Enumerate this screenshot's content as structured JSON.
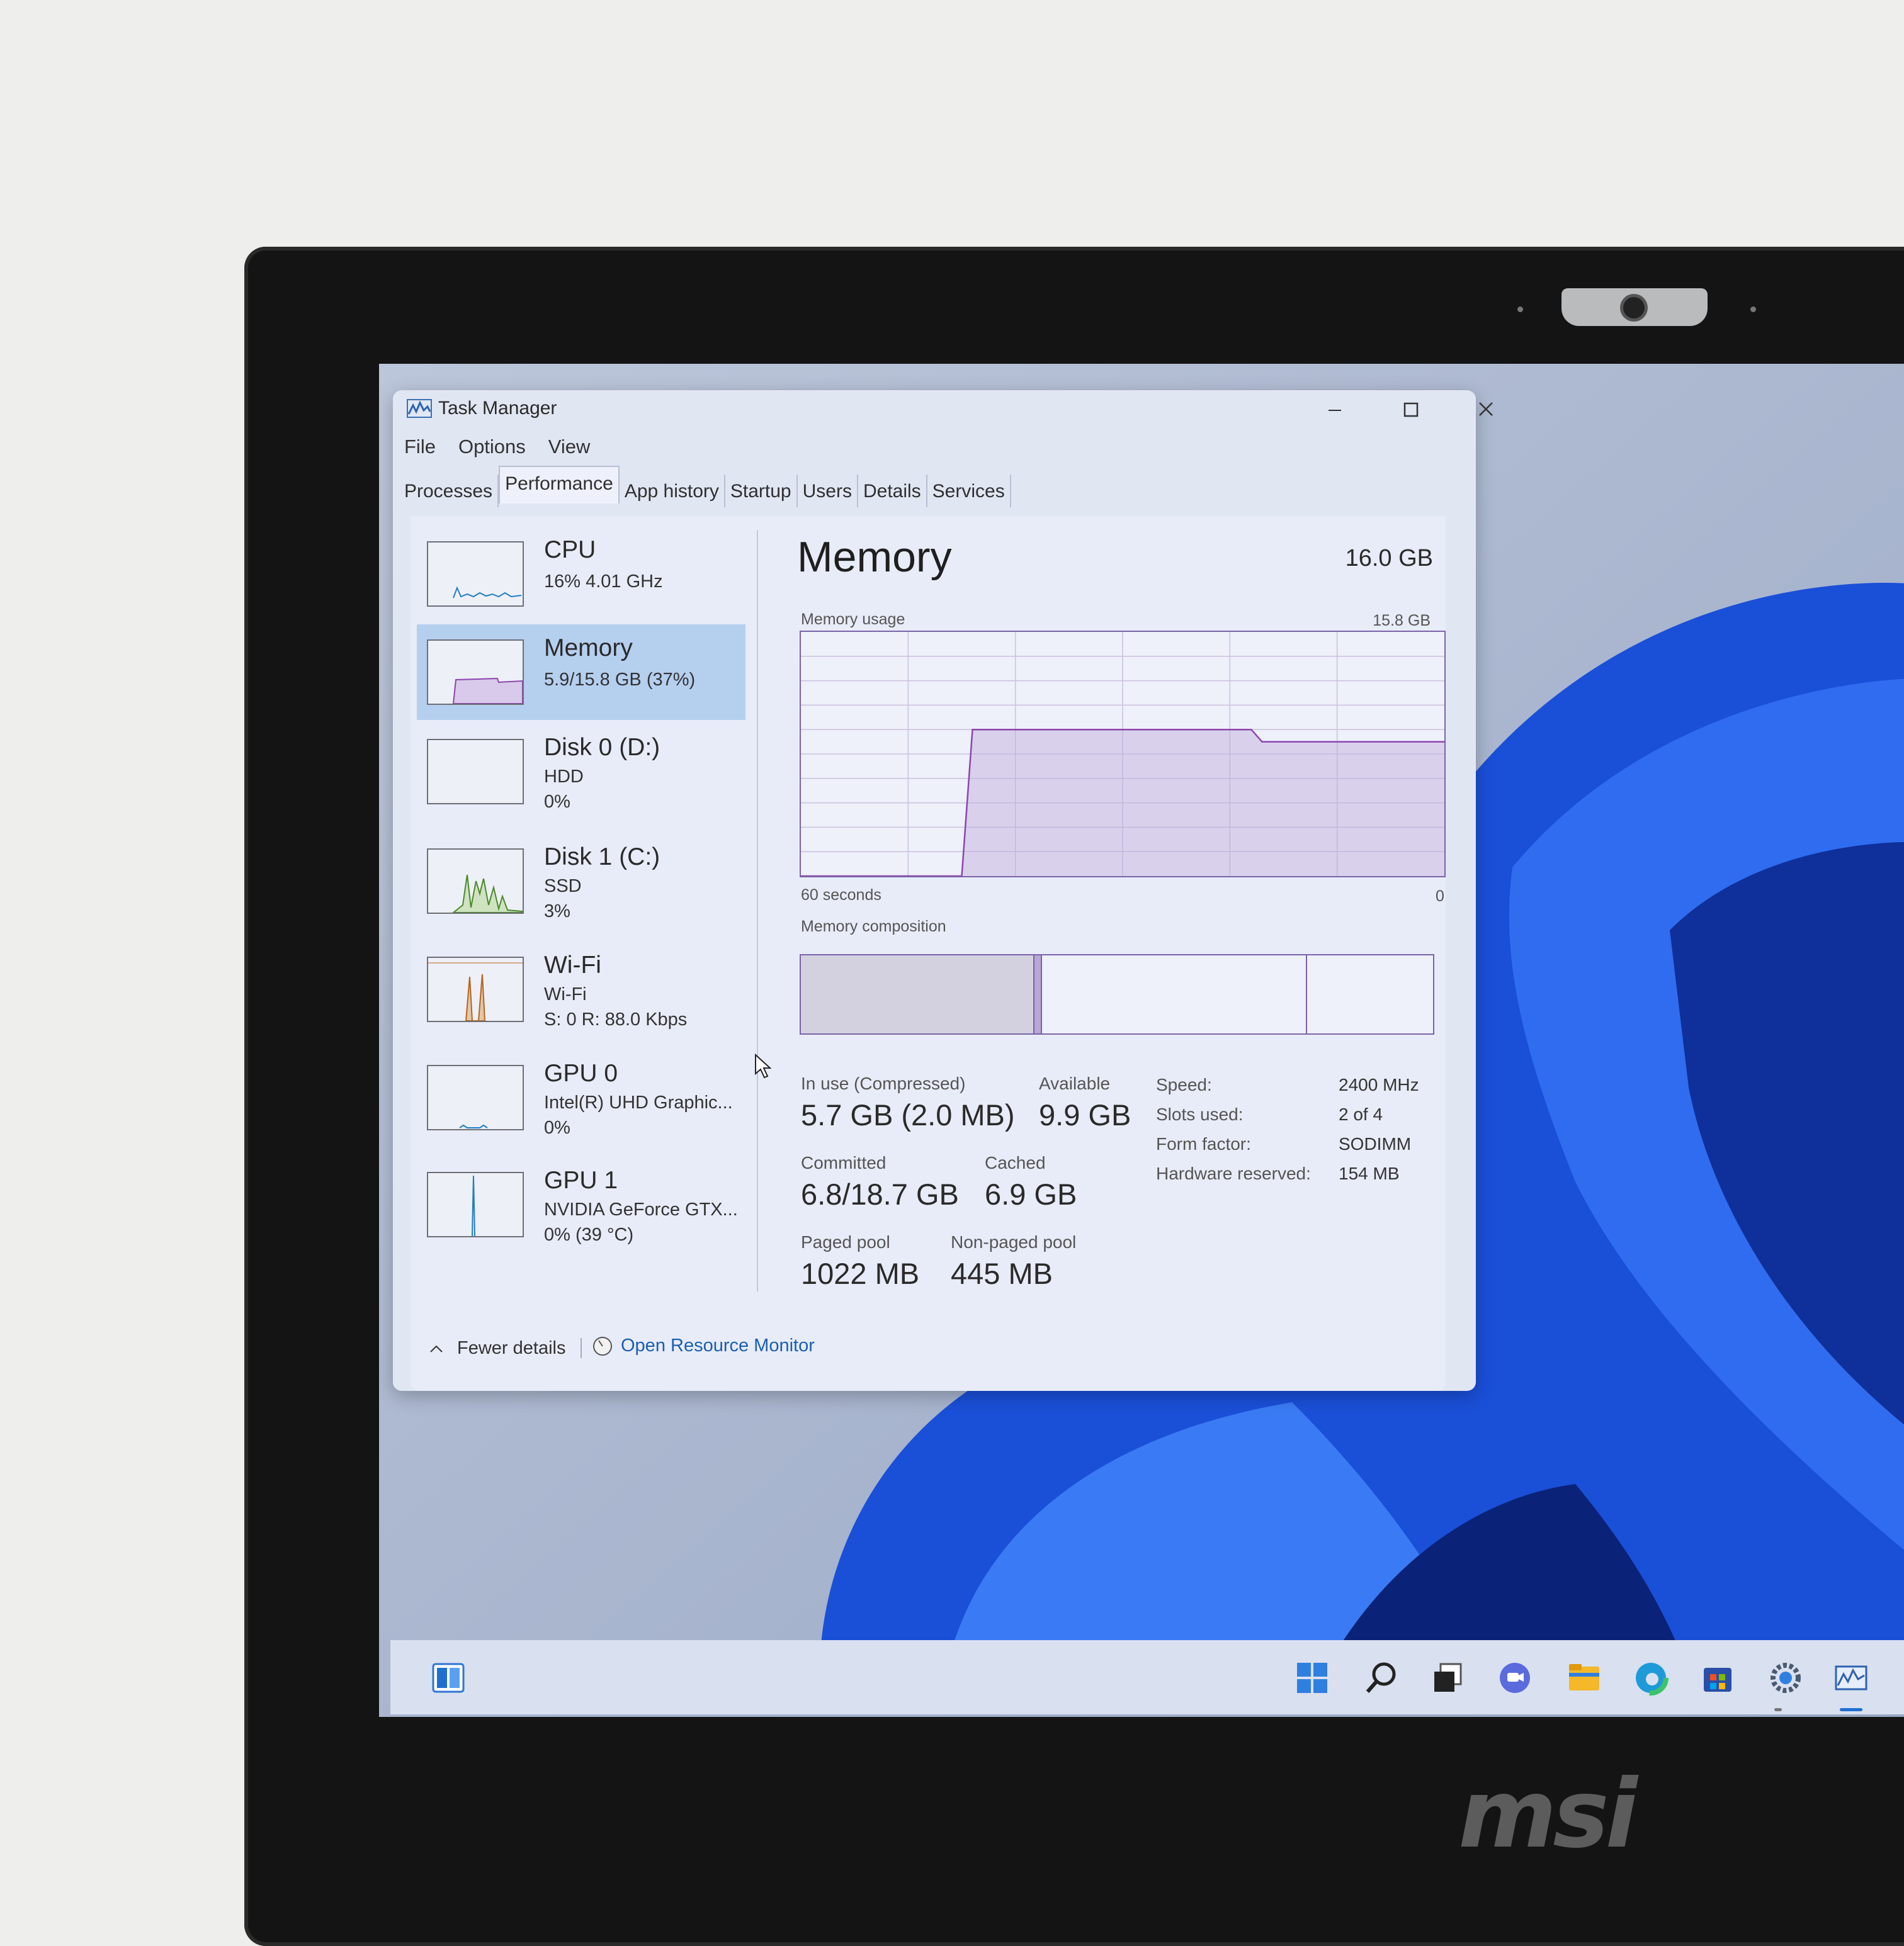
{
  "window": {
    "title": "Task Manager",
    "menu": [
      "File",
      "Options",
      "View"
    ],
    "tabs": [
      {
        "label": "Processes",
        "active": false
      },
      {
        "label": "Performance",
        "active": true
      },
      {
        "label": "App history",
        "active": false
      },
      {
        "label": "Startup",
        "active": false
      },
      {
        "label": "Users",
        "active": false
      },
      {
        "label": "Details",
        "active": false
      },
      {
        "label": "Services",
        "active": false
      }
    ]
  },
  "sidebar": [
    {
      "title": "CPU",
      "lines": [
        "16%  4.01 GHz"
      ],
      "color": "#1f7dc4"
    },
    {
      "title": "Memory",
      "lines": [
        "5.9/15.8 GB (37%)"
      ],
      "color": "#8e44ad",
      "selected": true
    },
    {
      "title": "Disk 0 (D:)",
      "lines": [
        "HDD",
        "0%"
      ],
      "color": "#4a8a2a"
    },
    {
      "title": "Disk 1 (C:)",
      "lines": [
        "SSD",
        "3%"
      ],
      "color": "#4a8a2a"
    },
    {
      "title": "Wi-Fi",
      "lines": [
        "Wi-Fi",
        "S: 0  R: 88.0 Kbps"
      ],
      "color": "#b5651d"
    },
    {
      "title": "GPU 0",
      "lines": [
        "Intel(R) UHD Graphic...",
        "0%"
      ],
      "color": "#1f7dc4"
    },
    {
      "title": "GPU 1",
      "lines": [
        "NVIDIA GeForce GTX...",
        "0%  (39 °C)"
      ],
      "color": "#1f7dc4"
    }
  ],
  "memory": {
    "heading": "Memory",
    "total": "16.0 GB",
    "usage_label": "Memory usage",
    "usage_max": "15.8 GB",
    "time_left": "60 seconds",
    "time_right": "0",
    "composition_label": "Memory composition",
    "stats": {
      "in_use_label": "In use (Compressed)",
      "in_use_value": "5.7 GB (2.0 MB)",
      "available_label": "Available",
      "available_value": "9.9 GB",
      "committed_label": "Committed",
      "committed_value": "6.8/18.7 GB",
      "cached_label": "Cached",
      "cached_value": "6.9 GB",
      "paged_label": "Paged pool",
      "paged_value": "1022 MB",
      "nonpaged_label": "Non-paged pool",
      "nonpaged_value": "445 MB"
    },
    "specs": [
      {
        "label": "Speed:",
        "value": "2400 MHz"
      },
      {
        "label": "Slots used:",
        "value": "2 of 4"
      },
      {
        "label": "Form factor:",
        "value": "SODIMM"
      },
      {
        "label": "Hardware reserved:",
        "value": "154 MB"
      }
    ],
    "usage_series_gb_percent": [
      0,
      0,
      0,
      0,
      0,
      0,
      0,
      0,
      0,
      0,
      0,
      0,
      0,
      0,
      0,
      0,
      60,
      60,
      60,
      60,
      60,
      60,
      60,
      60,
      60,
      60,
      60,
      60,
      60,
      60,
      60,
      60,
      60,
      60,
      60,
      60,
      60,
      60,
      60,
      60,
      60,
      60,
      60,
      55,
      55,
      55,
      55,
      55,
      55,
      55,
      55,
      55,
      55,
      55,
      55,
      55,
      55,
      55,
      55,
      55,
      55
    ],
    "composition_fractions": {
      "in_use": 0.37,
      "modified": 0.01,
      "standby": 0.42,
      "free": 0.2
    }
  },
  "footer": {
    "fewer_details": "Fewer details",
    "open_resource_monitor": "Open Resource Monitor"
  },
  "brand": "msi"
}
